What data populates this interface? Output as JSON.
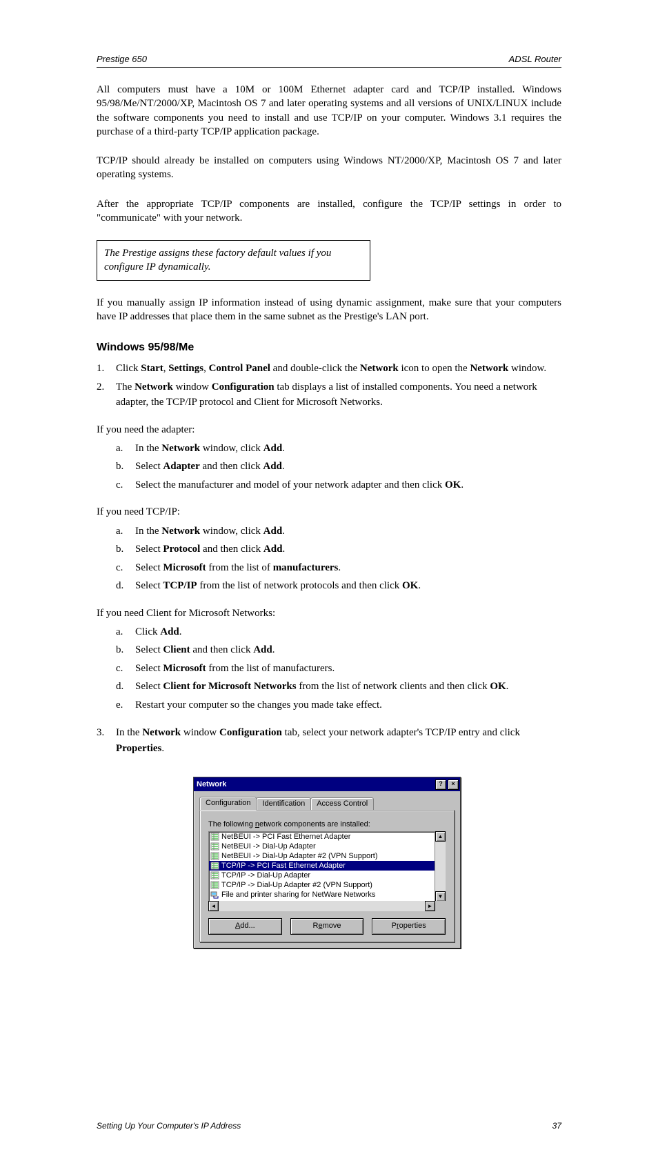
{
  "header": {
    "left": "Prestige 650",
    "right": "ADSL Router"
  },
  "paragraphs": {
    "intro": "All computers must have a 10M or 100M Ethernet adapter card and TCP/IP installed. Windows 95/98/Me/NT/2000/XP, Macintosh OS 7 and later operating systems and all versions of UNIX/LINUX include the software components you need to install and use TCP/IP on your computer. Windows 3.1 requires the purchase of a third-party TCP/IP application package.",
    "tcpip_note": "TCP/IP should already be installed on computers using Windows NT/2000/XP, Macintosh OS 7 and later operating systems.",
    "after_note": "After the appropriate TCP/IP components are installed, configure the TCP/IP settings in order to \"communicate\" with your network.",
    "dhcp": "If you manually assign IP information instead of using dynamic assignment, make sure that your computers have IP addresses that place them in the same subnet as the Prestige's LAN port."
  },
  "noteBox": "The Prestige assigns these factory default values if you configure IP dynamically.",
  "section1": {
    "heading": "Windows 95/98/Me",
    "steps": {
      "s1_pre": "Click ",
      "s1_b1": "Start",
      "s1_mid1": ", ",
      "s1_b2": "Settings",
      "s1_mid2": ", ",
      "s1_b3": "Control Panel",
      "s1_mid3": " and double-click the ",
      "s1_b4": "Network",
      "s1_mid4": " icon to open the ",
      "s1_b5": "Network",
      "s1_end": " window.",
      "s2_pre": "The ",
      "s2_b1": "Network",
      "s2_mid1": " window ",
      "s2_b2": "Configuration",
      "s2_end": " tab displays a list of installed components. You need a network adapter, the TCP/IP protocol and Client for Microsoft Networks."
    },
    "sub": {
      "lead": "If you need the adapter:",
      "a_pre": "In the ",
      "a_b1": "Network",
      "a_mid1": " window, click ",
      "a_b2": "Add",
      "a_end": ".",
      "b_pre": "Select ",
      "b_b1": "Adapter",
      "b_mid1": " and then click ",
      "b_b2": "Add",
      "b_end": ".",
      "c": "Select the manufacturer and model of your network adapter and then click ",
      "c_b1": "OK",
      "c_end": "."
    },
    "sub2": {
      "lead": "If you need TCP/IP:",
      "a_pre": "In the ",
      "a_b1": "Network",
      "a_mid1": " window, click ",
      "a_b2": "Add",
      "a_end": ".",
      "b_pre": "Select ",
      "b_b1": "Protocol",
      "b_mid1": " and then click ",
      "b_b2": "Add",
      "b_end": ".",
      "c_pre": "Select ",
      "c_b1": "Microsoft",
      "c_mid1": " from the list of ",
      "c_b2": "manufacturers",
      "c_end": ".",
      "d_pre": "Select ",
      "d_b1": "TCP/IP",
      "d_mid1": " from the list of network protocols and then click ",
      "d_b2": "OK",
      "d_end": "."
    },
    "sub3": {
      "lead": "If you need Client for Microsoft Networks:",
      "a_pre": "Click ",
      "a_b1": "Add",
      "a_end": ".",
      "b_pre": "Select ",
      "b_b1": "Client",
      "b_mid1": " and then click ",
      "b_b2": "Add",
      "b_end": ".",
      "c_pre": "Select ",
      "c_b1": "Microsoft",
      "c_mid1": " from the list of manufacturers.",
      "d_pre": "Select ",
      "d_b1": "Client for Microsoft Networks",
      "d_mid1": " from the list of network clients and then click ",
      "d_b2": "OK",
      "d_end": ".",
      "e": "Restart your computer so the changes you made take effect."
    },
    "step3_pre": "In the ",
    "step3_b1": "Network",
    "step3_mid1": " window ",
    "step3_b2": "Configuration",
    "step3_mid2": " tab, select your network adapter's TCP/IP entry and click ",
    "step3_b3": "Properties",
    "step3_end": "."
  },
  "dialog": {
    "title": "Network",
    "tabs": [
      "Configuration",
      "Identification",
      "Access Control"
    ],
    "panelLabel_pre": "The following ",
    "panelLabel_und": "n",
    "panelLabel_post": "etwork components are installed:",
    "items": [
      "NetBEUI -> PCI Fast Ethernet Adapter",
      "NetBEUI -> Dial-Up Adapter",
      "NetBEUI -> Dial-Up Adapter #2 (VPN Support)",
      "TCP/IP -> PCI Fast Ethernet Adapter",
      "TCP/IP -> Dial-Up Adapter",
      "TCP/IP -> Dial-Up Adapter #2 (VPN Support)",
      "File and printer sharing for NetWare Networks"
    ],
    "buttons": {
      "add_pre": "",
      "add_und": "A",
      "add_post": "dd...",
      "rem_pre": "R",
      "rem_und": "e",
      "rem_post": "move",
      "prop_pre": "P",
      "prop_und": "r",
      "prop_post": "operties"
    }
  },
  "footer": {
    "left": "Setting Up Your Computer's IP Address",
    "right": "37"
  }
}
